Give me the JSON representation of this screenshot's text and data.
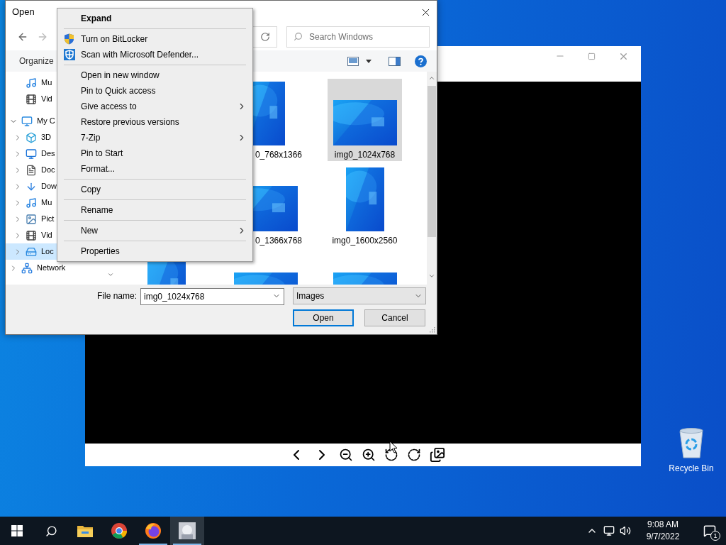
{
  "desktop": {
    "recycle_bin": "Recycle Bin"
  },
  "dialog": {
    "title": "Open",
    "search": {
      "placeholder": "Search Windows"
    },
    "organize": "Organize",
    "nav": [
      {
        "children": [
          {
            "label": "Mu",
            "kind": "music",
            "selected": false
          },
          {
            "label": "Vid",
            "kind": "video",
            "selected": false
          }
        ]
      },
      {
        "label": "My C",
        "kind": "pc",
        "expanded": true,
        "selected": false,
        "children": [
          {
            "label": "3D",
            "kind": "objects",
            "expanded": false,
            "selected": false
          },
          {
            "label": "Des",
            "kind": "desktop",
            "expanded": false,
            "selected": false
          },
          {
            "label": "Doc",
            "kind": "documents",
            "expanded": false,
            "selected": false
          },
          {
            "label": "Dow",
            "kind": "downloads",
            "expanded": false,
            "selected": false
          },
          {
            "label": "Mu",
            "kind": "music",
            "expanded": false,
            "selected": false
          },
          {
            "label": "Pict",
            "kind": "pictures",
            "expanded": false,
            "selected": false
          },
          {
            "label": "Vid",
            "kind": "video",
            "expanded": false,
            "selected": false
          },
          {
            "label": "Loc",
            "kind": "drive",
            "expanded": false,
            "selected": true
          }
        ]
      },
      {
        "label": "Network",
        "kind": "network",
        "expanded": false,
        "selected": false
      }
    ],
    "files": [
      [
        {
          "label": "0_768x1366",
          "kind": "portrait",
          "selected": false
        },
        {
          "label": "img0_1024x768",
          "kind": "landscape",
          "selected": true
        }
      ],
      [
        {
          "label": "0_1366x768",
          "kind": "landscape",
          "selected": false
        },
        {
          "label": "img0_1600x2560",
          "kind": "portrait",
          "selected": false
        }
      ],
      [
        {
          "kind": "portrait",
          "selected": false
        },
        {
          "kind": "landscape",
          "selected": false
        },
        {
          "kind": "landscape",
          "selected": false
        }
      ]
    ],
    "file_name": {
      "label": "File name:",
      "value": "img0_1024x768"
    },
    "file_type": "Images",
    "buttons": [
      {
        "label": "Open",
        "default": true
      },
      {
        "label": "Cancel",
        "default": false
      }
    ]
  },
  "context_menu": [
    [
      {
        "label": "Expand",
        "default": true,
        "kind": "plain",
        "submenu": false
      }
    ],
    [
      {
        "label": "Turn on BitLocker",
        "default": false,
        "kind": "bitlocker",
        "submenu": false
      },
      {
        "label": "Scan with Microsoft Defender...",
        "default": false,
        "kind": "defender",
        "submenu": false
      }
    ],
    [
      {
        "label": "Open in new window",
        "default": false,
        "kind": "plain",
        "submenu": false
      },
      {
        "label": "Pin to Quick access",
        "default": false,
        "kind": "plain",
        "submenu": false
      },
      {
        "label": "Give access to",
        "default": false,
        "kind": "plain",
        "submenu": true
      },
      {
        "label": "Restore previous versions",
        "default": false,
        "kind": "plain",
        "submenu": false
      },
      {
        "label": "7-Zip",
        "default": false,
        "kind": "plain",
        "submenu": true
      },
      {
        "label": "Pin to Start",
        "default": false,
        "kind": "plain",
        "submenu": false
      },
      {
        "label": "Format...",
        "default": false,
        "kind": "plain",
        "submenu": false
      }
    ],
    [
      {
        "label": "Copy",
        "default": false,
        "kind": "plain",
        "submenu": false
      }
    ],
    [
      {
        "label": "Rename",
        "default": false,
        "kind": "plain",
        "submenu": false
      }
    ],
    [
      {
        "label": "New",
        "default": false,
        "kind": "plain",
        "submenu": true
      }
    ],
    [
      {
        "label": "Properties",
        "default": false,
        "kind": "plain",
        "submenu": false
      }
    ]
  ],
  "taskbar": {
    "apps": [
      {
        "kind": "explorer",
        "running": false,
        "active": false
      },
      {
        "kind": "chrome",
        "running": false,
        "active": false
      },
      {
        "kind": "firefox",
        "running": true,
        "active": false
      },
      {
        "kind": "viewer",
        "running": true,
        "active": true
      }
    ],
    "time": "9:08 AM",
    "date": "9/7/2022",
    "notifications": "1"
  }
}
